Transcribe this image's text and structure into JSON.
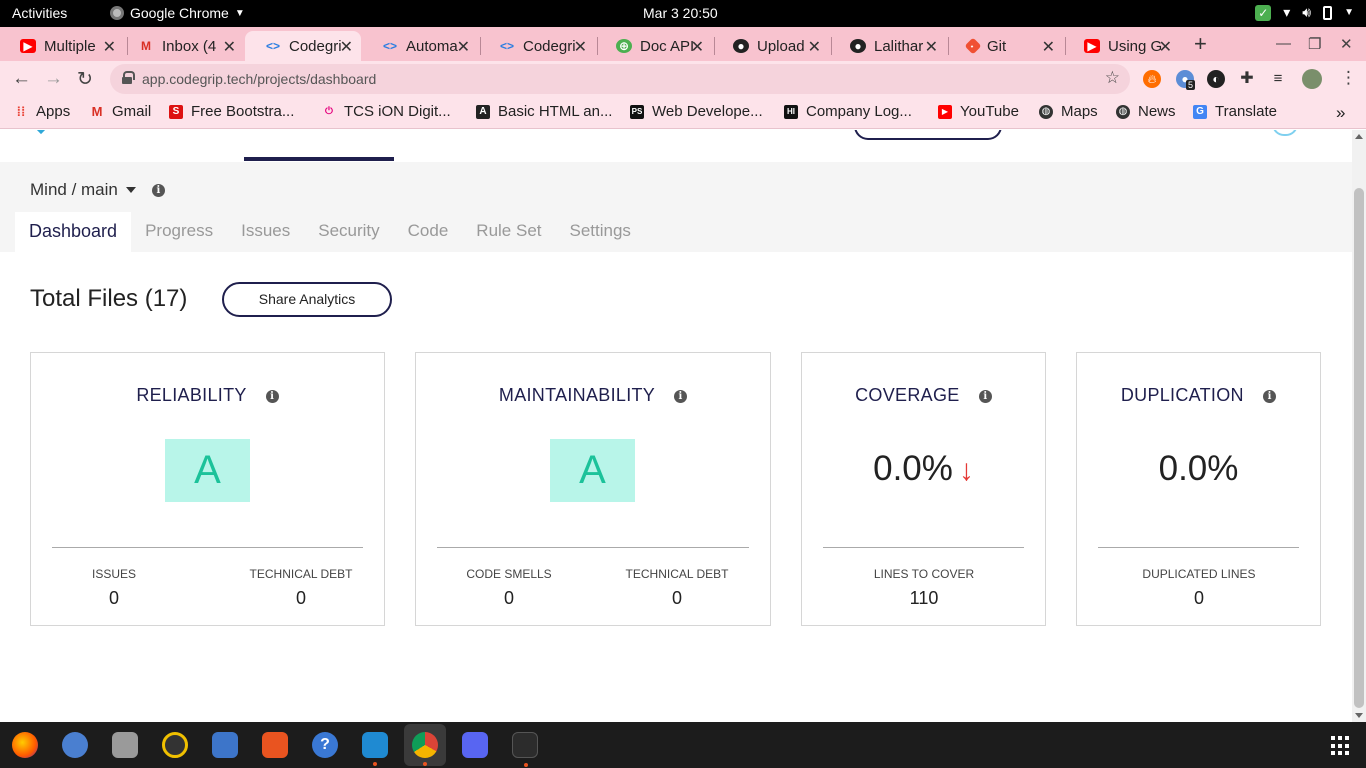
{
  "system": {
    "activities": "Activities",
    "app_name": "Google Chrome",
    "clock": "Mar 3  20:50"
  },
  "tabs": [
    {
      "label": "Multiple",
      "icon": "youtube-icon"
    },
    {
      "label": "Inbox (4",
      "icon": "gmail-icon"
    },
    {
      "label": "Codegri",
      "icon": "codegrip-icon",
      "active": true
    },
    {
      "label": "Automa",
      "icon": "codegrip-icon"
    },
    {
      "label": "Codegri",
      "icon": "codegrip-icon"
    },
    {
      "label": "Doc API",
      "icon": "docapi-icon"
    },
    {
      "label": "Upload",
      "icon": "github-icon"
    },
    {
      "label": "Lalithar",
      "icon": "github-icon"
    },
    {
      "label": "Git",
      "icon": "git-icon"
    },
    {
      "label": "Using G",
      "icon": "youtube-icon"
    }
  ],
  "address_bar": {
    "url": "app.codegrip.tech/projects/dashboard"
  },
  "bookmarks": [
    {
      "label": "Apps"
    },
    {
      "label": "Gmail"
    },
    {
      "label": "Free Bootstra..."
    },
    {
      "label": "TCS iON Digit..."
    },
    {
      "label": "Basic HTML an..."
    },
    {
      "label": "Web Develope..."
    },
    {
      "label": "Company Log..."
    },
    {
      "label": "YouTube"
    },
    {
      "label": "Maps"
    },
    {
      "label": "News"
    },
    {
      "label": "Translate"
    }
  ],
  "extension_badge": "5",
  "project": {
    "name": "Mind / main"
  },
  "project_tabs": [
    "Dashboard",
    "Progress",
    "Issues",
    "Security",
    "Code",
    "Rule Set",
    "Settings"
  ],
  "dashboard": {
    "total_files": "Total Files (17)",
    "share_button": "Share Analytics",
    "cards": {
      "reliability": {
        "title": "RELIABILITY",
        "grade": "A",
        "metrics": [
          {
            "label": "ISSUES",
            "value": "0"
          },
          {
            "label": "TECHNICAL DEBT",
            "value": "0"
          }
        ]
      },
      "maintainability": {
        "title": "MAINTAINABILITY",
        "grade": "A",
        "metrics": [
          {
            "label": "CODE SMELLS",
            "value": "0"
          },
          {
            "label": "TECHNICAL DEBT",
            "value": "0"
          }
        ]
      },
      "coverage": {
        "title": "COVERAGE",
        "value": "0.0%",
        "trend": "down",
        "metrics": [
          {
            "label": "LINES TO COVER",
            "value": "110"
          }
        ]
      },
      "duplication": {
        "title": "DUPLICATION",
        "value": "0.0%",
        "metrics": [
          {
            "label": "DUPLICATED LINES",
            "value": "0"
          }
        ]
      }
    }
  },
  "colors": {
    "brand_navy": "#1f1f4d",
    "grade_bg": "#b8f5e9",
    "grade_text": "#1cc29a",
    "trend_down": "#e53935",
    "tabstrip": "#f8c3cf"
  }
}
